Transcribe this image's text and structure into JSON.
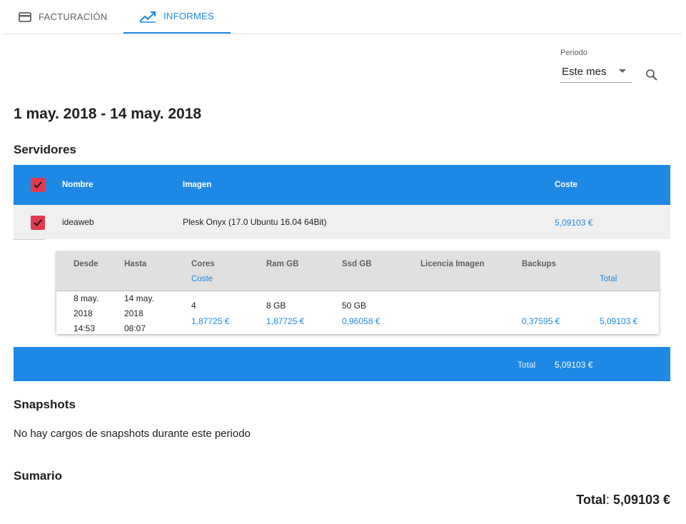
{
  "tabs": [
    {
      "label": "FACTURACIÓN",
      "icon": "credit-card-icon"
    },
    {
      "label": "INFORMES",
      "icon": "trending-up-icon"
    }
  ],
  "period": {
    "label": "Periodo",
    "value": "Este mes"
  },
  "date_range": "1 may. 2018 - 14 may. 2018",
  "servers": {
    "title": "Servidores",
    "headers": {
      "name": "Nombre",
      "image": "Imagen",
      "cost": "Coste"
    },
    "row": {
      "name": "ideaweb",
      "image": "Plesk Onyx (17.0 Ubuntu 16.04 64Bit)",
      "cost": "5,09103 €"
    },
    "detail": {
      "headers": {
        "from": "Desde",
        "to": "Hasta",
        "cores": "Cores",
        "cost_sub": "Coste",
        "ram": "Ram GB",
        "ssd": "Ssd GB",
        "license": "Licencia Imagen",
        "backups": "Backups",
        "total": "Total"
      },
      "row": {
        "from_date": "8 may.",
        "from_year": "2018",
        "from_time": "14:53",
        "to_date": "14 may.",
        "to_year": "2018",
        "to_time": "08:07",
        "cores": "4",
        "cores_cost": "1,87725 €",
        "ram": "8 GB",
        "ram_cost": "1,87725 €",
        "ssd": "50 GB",
        "ssd_cost": "0,96058 €",
        "backups_cost": "0,37595 €",
        "total": "5,09103 €"
      }
    },
    "total_label": "Total",
    "total_value": "5,09103 €"
  },
  "snapshots": {
    "title": "Snapshots",
    "message": "No hay cargos de snapshots durante este periodo"
  },
  "summary": {
    "title": "Sumario",
    "total_label": "Total",
    "total_value": "5,09103 €"
  },
  "colors": {
    "accent": "#1e88e5",
    "checkbox": "#e53950"
  }
}
